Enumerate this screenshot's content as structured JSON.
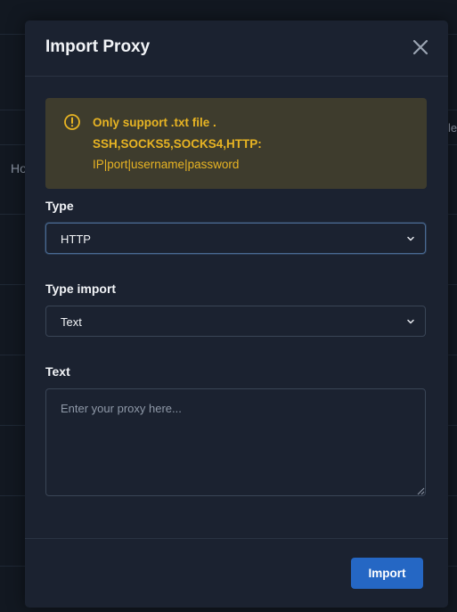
{
  "background": {
    "left_text": "Ho",
    "right_text": "le"
  },
  "modal": {
    "title": "Import Proxy",
    "close_icon": "close-icon",
    "alert": {
      "icon": "warning-circle-icon",
      "line1": "Only support .txt file .",
      "line2": "SSH,SOCKS5,SOCKS4,HTTP:",
      "line3": "IP|port|username|password",
      "color": "#e8b423"
    },
    "type_field": {
      "label": "Type",
      "value": "HTTP"
    },
    "type_import_field": {
      "label": "Type import",
      "value": "Text"
    },
    "text_field": {
      "label": "Text",
      "value": "",
      "placeholder": "Enter your proxy here..."
    },
    "footer": {
      "import_label": "Import",
      "accent": "#2567c4"
    }
  }
}
